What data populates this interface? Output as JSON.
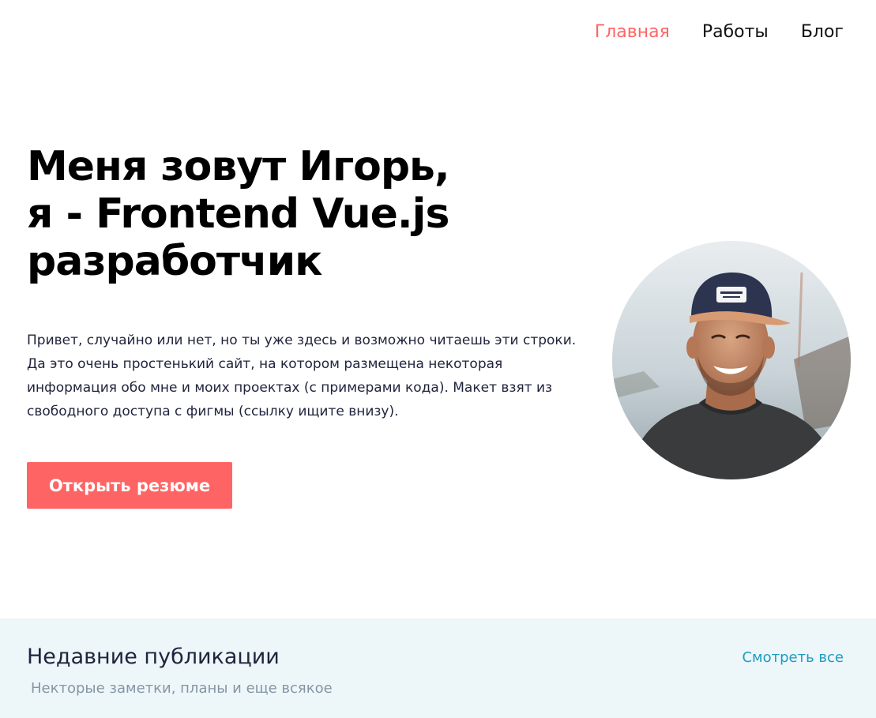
{
  "nav": {
    "items": [
      {
        "label": "Главная",
        "active": true
      },
      {
        "label": "Работы",
        "active": false
      },
      {
        "label": "Блог",
        "active": false
      }
    ]
  },
  "hero": {
    "title_lines": [
      "Меня зовут Игорь,",
      "я - Frontend Vue.js",
      "разработчик"
    ],
    "text": "Привет, случайно или нет, но ты уже здесь и возможно читаешь эти строки. Да это очень простенький сайт, на котором размещена некоторая информация обо мне и моих проектах (с примерами кода). Макет взят из свободного доступа с фигмы (ссылку ищите внизу).",
    "resume_button": "Открыть резюме",
    "avatar_icon": "avatar-photo"
  },
  "recent": {
    "title": "Недавние публикации",
    "subtitle": "Некторые заметки, планы и еще всякое",
    "view_all": "Смотреть все"
  },
  "colors": {
    "accent": "#FF6464",
    "link": "#1E9BBF",
    "band_bg": "#EDF7FA",
    "muted_text": "#8695A4"
  }
}
